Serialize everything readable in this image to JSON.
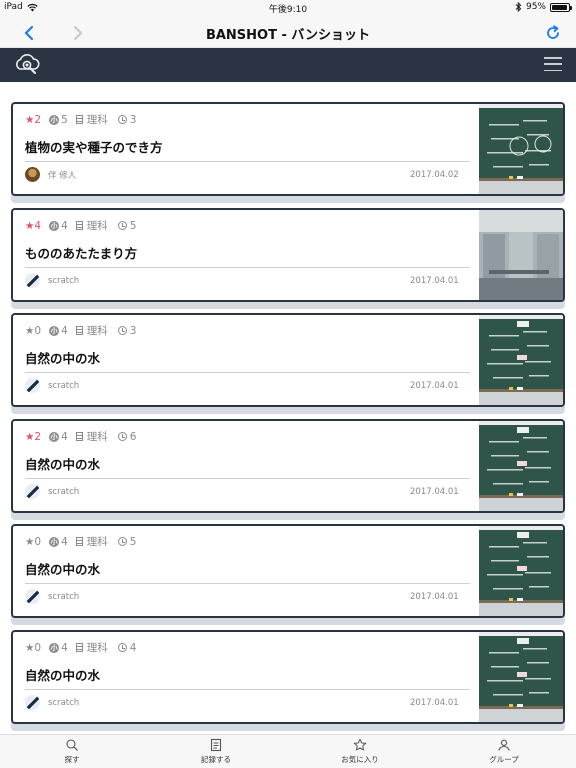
{
  "status_bar": {
    "device": "iPad",
    "time": "午後9:10",
    "battery": "95%",
    "battery_level": 0.95
  },
  "nav": {
    "title": "BANSHOT - バンショット",
    "back_icon": "chevron-left-icon",
    "forward_icon": "chevron-right-icon",
    "reload_icon": "reload-icon"
  },
  "app_bar": {
    "logo_icon": "cloud-eye-logo-icon",
    "menu_icon": "hamburger-menu-icon"
  },
  "colors": {
    "accent": "#1a7cf4",
    "header_bg": "#2b3442",
    "favorite_star": "#e2506a",
    "muted": "#8a8a8a"
  },
  "posts": [
    {
      "stars": "★2",
      "starred": true,
      "grade": "5",
      "subject": "理科",
      "views": "3",
      "title": "植物の実や種子のでき方",
      "author": "伴 修人",
      "date": "2017.04.02",
      "thumb": "board-1"
    },
    {
      "stars": "★4",
      "starred": true,
      "grade": "4",
      "subject": "理科",
      "views": "5",
      "title": "もののあたたまり方",
      "author": "scratch",
      "date": "2017.04.01",
      "thumb": "room"
    },
    {
      "stars": "★0",
      "starred": false,
      "grade": "4",
      "subject": "理科",
      "views": "3",
      "title": "自然の中の水",
      "author": "scratch",
      "date": "2017.04.01",
      "thumb": "board"
    },
    {
      "stars": "★2",
      "starred": true,
      "grade": "4",
      "subject": "理科",
      "views": "6",
      "title": "自然の中の水",
      "author": "scratch",
      "date": "2017.04.01",
      "thumb": "board"
    },
    {
      "stars": "★0",
      "starred": false,
      "grade": "4",
      "subject": "理科",
      "views": "5",
      "title": "自然の中の水",
      "author": "scratch",
      "date": "2017.04.01",
      "thumb": "board"
    },
    {
      "stars": "★0",
      "starred": false,
      "grade": "4",
      "subject": "理科",
      "views": "4",
      "title": "自然の中の水",
      "author": "scratch",
      "date": "2017.04.01",
      "thumb": "board"
    }
  ],
  "grade_badge_char": "小",
  "tabs": [
    {
      "label": "探す",
      "icon": "search-icon"
    },
    {
      "label": "記録する",
      "icon": "record-icon"
    },
    {
      "label": "お気に入り",
      "icon": "star-icon"
    },
    {
      "label": "グループ",
      "icon": "group-icon"
    }
  ]
}
